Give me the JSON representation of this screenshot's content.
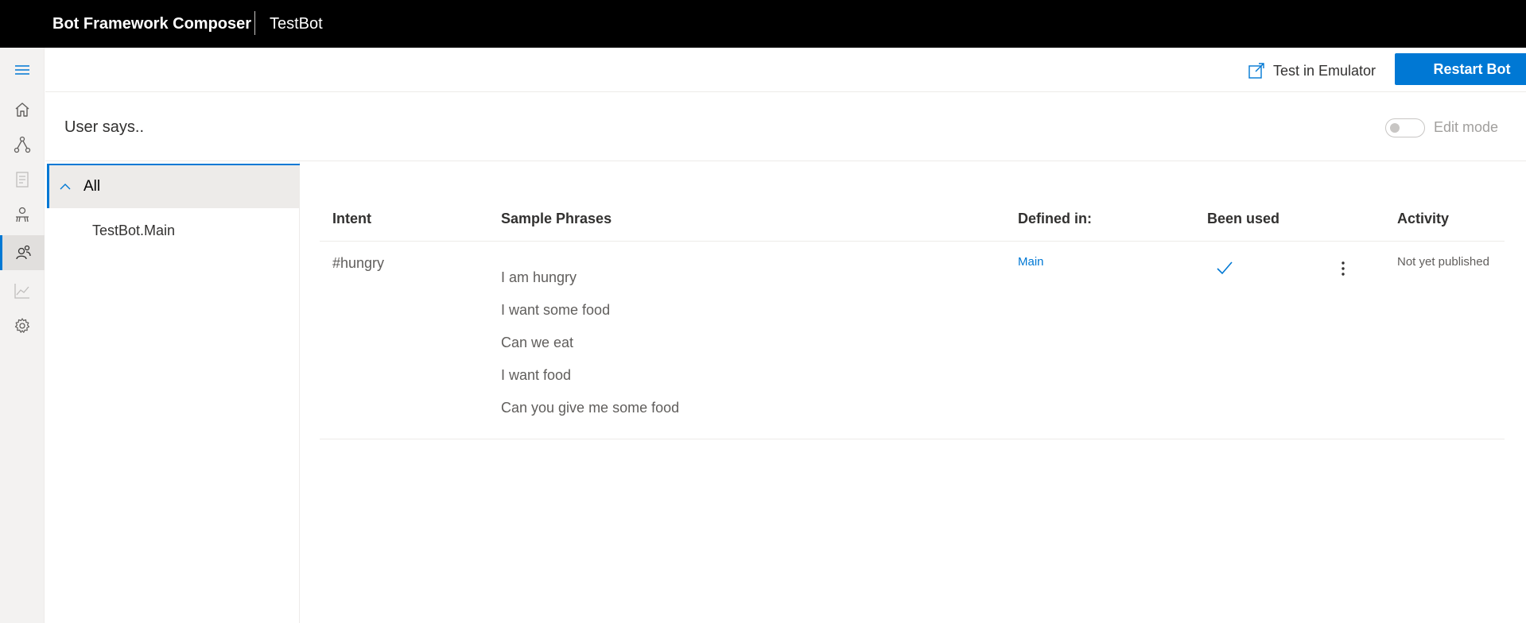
{
  "header": {
    "app_title": "Bot Framework Composer",
    "project_name": "TestBot"
  },
  "nav": {
    "items": [
      {
        "name": "menu-icon"
      },
      {
        "name": "home-icon"
      },
      {
        "name": "design-flow-icon"
      },
      {
        "name": "bot-responses-icon"
      },
      {
        "name": "language-generation-icon"
      },
      {
        "name": "language-understanding-icon"
      },
      {
        "name": "analytics-icon"
      },
      {
        "name": "settings-icon"
      }
    ],
    "accent_color": "#0078d4"
  },
  "toolbar": {
    "emulator_label": "Test in Emulator",
    "restart_label": "Restart Bot"
  },
  "page": {
    "title": "User says..",
    "edit_mode_label": "Edit mode",
    "edit_mode_on": false
  },
  "tree": {
    "all_label": "All",
    "items": [
      "TestBot.Main"
    ]
  },
  "table": {
    "columns": [
      "Intent",
      "Sample Phrases",
      "Defined in:",
      "Been used",
      "Activity"
    ],
    "rows": [
      {
        "intent": "#hungry",
        "phrases": [
          "I am hungry",
          "I want some food",
          "Can we eat",
          "I want food",
          "Can you give me some food"
        ],
        "defined_in": "Main",
        "been_used": true,
        "activity": "Not yet published"
      }
    ]
  }
}
